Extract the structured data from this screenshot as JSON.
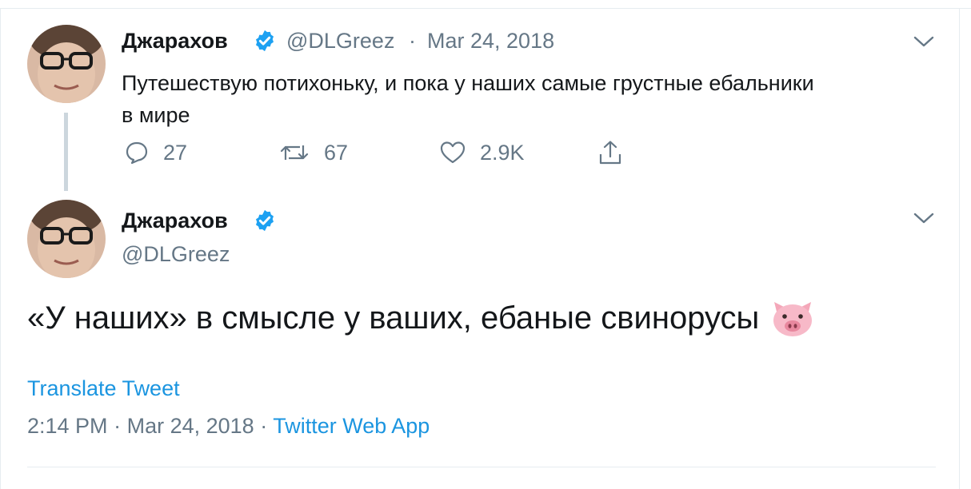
{
  "tweet1": {
    "author_name": "Джарахов",
    "handle": "@DLGreez",
    "separator": "·",
    "date": "Mar 24, 2018",
    "text_line1": "Путешествую потихоньку, и пока у наших самые грустные ебальники",
    "text_line2": "в мире",
    "replies": "27",
    "retweets": "67",
    "likes": "2.9K"
  },
  "tweet2": {
    "author_name": "Джарахов",
    "handle": "@DLGreez",
    "text": "«У наших» в смысле у ваших, ебаные свинорусы",
    "emoji": "pig-face",
    "translate_label": "Translate Tweet",
    "time": "2:14 PM",
    "separator": "·",
    "date": "Mar 24, 2018",
    "separator2": "·",
    "source": "Twitter Web App"
  },
  "icons": [
    "verified-badge-icon",
    "chevron-down-icon",
    "reply-icon",
    "retweet-icon",
    "like-icon",
    "share-icon",
    "pig-face-icon"
  ],
  "colors": {
    "verified": "#1da1f2",
    "link": "#1b95e0",
    "muted": "#657786",
    "text": "#14171a",
    "divider": "#e6ecf0",
    "thread_line": "#ccd6dd"
  }
}
